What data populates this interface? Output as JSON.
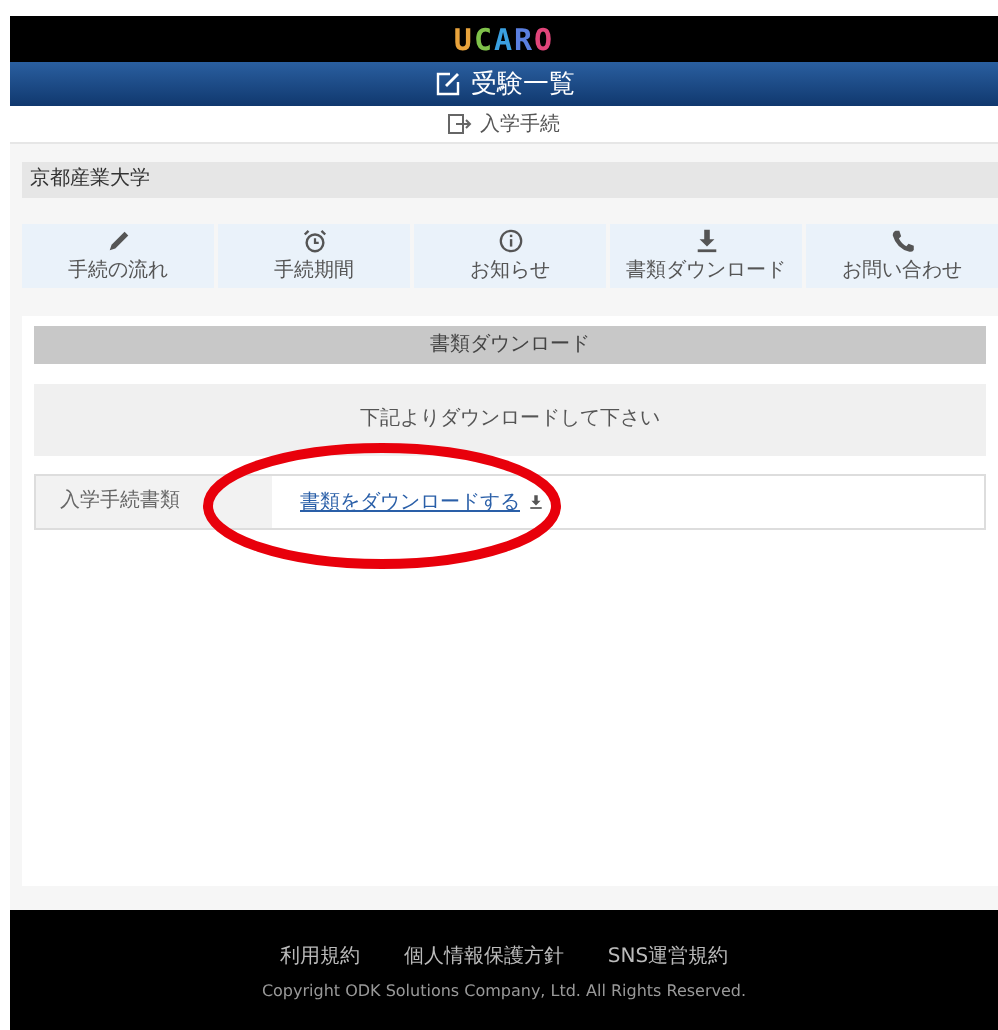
{
  "header": {
    "logo": [
      {
        "letter": "U",
        "color": "#e8a33c"
      },
      {
        "letter": "C",
        "color": "#7fc24a"
      },
      {
        "letter": "A",
        "color": "#3aa0e0"
      },
      {
        "letter": "R",
        "color": "#5a7fe0"
      },
      {
        "letter": "O",
        "color": "#e0457a"
      }
    ]
  },
  "title_bar": {
    "title": "受験一覧"
  },
  "breadcrumb": {
    "label": "入学手続"
  },
  "university": {
    "name": "京都産業大学"
  },
  "nav": [
    {
      "label": "手続の流れ",
      "kind": "pencil"
    },
    {
      "label": "手続期間",
      "kind": "alarm"
    },
    {
      "label": "お知らせ",
      "kind": "info"
    },
    {
      "label": "書類ダウンロード",
      "kind": "download"
    },
    {
      "label": "お問い合わせ",
      "kind": "phone"
    }
  ],
  "section": {
    "heading": "書類ダウンロード",
    "notice": "下記よりダウンロードして下さい",
    "rows": [
      {
        "label": "入学手続書類",
        "link": "書類をダウンロードする"
      }
    ]
  },
  "annotation": {
    "kind": "ellipse",
    "color": "#e8000b"
  },
  "footer": {
    "links": [
      "利用規約",
      "個人情報保護方針",
      "SNS運営規約"
    ],
    "copyright": "Copyright ODK Solutions Company, Ltd. All Rights Reserved."
  }
}
